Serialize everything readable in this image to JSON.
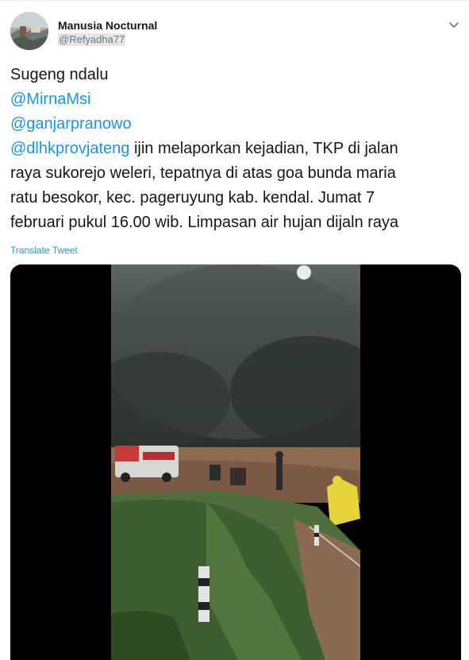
{
  "user": {
    "name": "Manusia Nocturnal",
    "handle": "@Refyadha77"
  },
  "tweet": {
    "line1": "Sugeng ndalu",
    "mention1": "@MirnaMsi",
    "mention2": "@ganjarpranowo",
    "mention3": "@dlhkprovjateng",
    "line4_rest": " ijin melaporkan kejadian, TKP di jalan",
    "line5": "raya sukorejo weleri, tepatnya di atas goa bunda maria",
    "line6": "ratu besokor, kec. pageruyung kab. kendal. Jumat 7",
    "line7": "februari pukul 16.00 wib. Limpasan air hujan dijaln raya"
  },
  "translate_label": "Translate Tweet",
  "icons": {
    "caret": "chevron-down-icon"
  },
  "colors": {
    "link": "#1b95e0",
    "text": "#14171a",
    "secondary": "#657786"
  }
}
